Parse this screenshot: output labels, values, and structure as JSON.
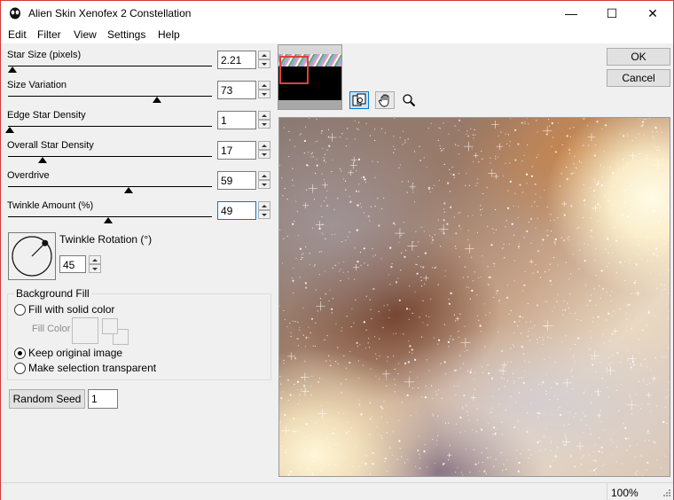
{
  "window": {
    "title": "Alien Skin Xenofex 2 Constellation",
    "minimize_glyph": "—",
    "maximize_glyph": "☐",
    "close_glyph": "✕"
  },
  "menu": [
    "Edit",
    "Filter",
    "View",
    "Settings",
    "Help"
  ],
  "sliders": [
    {
      "label": "Star Size (pixels)",
      "value": "2.21",
      "fraction": 0.02
    },
    {
      "label": "Size Variation",
      "value": "73",
      "fraction": 0.73
    },
    {
      "label": "Edge Star Density",
      "value": "1",
      "fraction": 0.01
    },
    {
      "label": "Overall Star Density",
      "value": "17",
      "fraction": 0.17
    },
    {
      "label": "Overdrive",
      "value": "59",
      "fraction": 0.59
    },
    {
      "label": "Twinkle Amount (%)",
      "value": "49",
      "fraction": 0.49
    }
  ],
  "twinkle_rotation": {
    "label": "Twinkle Rotation (°)",
    "value": "45",
    "angle_deg": 45
  },
  "background_fill": {
    "title": "Background Fill",
    "fill_solid": "Fill with solid color",
    "fill_color_label": "Fill Color",
    "keep_original": "Keep original image",
    "make_transparent": "Make selection transparent",
    "selected": "keep_original"
  },
  "random_seed": {
    "label": "Random Seed",
    "value": "1"
  },
  "buttons": {
    "ok": "OK",
    "cancel": "Cancel"
  },
  "tools": [
    "compare-icon",
    "hand-icon",
    "zoom-icon"
  ],
  "status": {
    "zoom": "100%"
  },
  "colors": {
    "accent": "#0078d7",
    "thumb_highlight": "#e0403a"
  }
}
